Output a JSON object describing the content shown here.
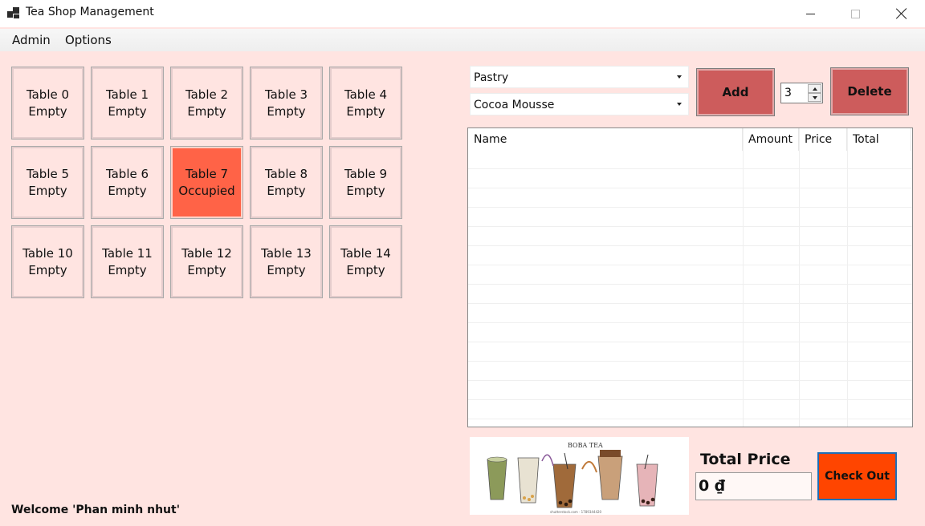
{
  "window": {
    "title": "Tea Shop Management"
  },
  "menu": {
    "admin": "Admin",
    "options": "Options"
  },
  "tables": [
    {
      "name": "Table 0",
      "status": "Empty"
    },
    {
      "name": "Table 1",
      "status": "Empty"
    },
    {
      "name": "Table 2",
      "status": "Empty"
    },
    {
      "name": "Table 3",
      "status": "Empty"
    },
    {
      "name": "Table 4",
      "status": "Empty"
    },
    {
      "name": "Table 5",
      "status": "Empty"
    },
    {
      "name": "Table 6",
      "status": "Empty"
    },
    {
      "name": "Table 7",
      "status": "Occupied"
    },
    {
      "name": "Table 8",
      "status": "Empty"
    },
    {
      "name": "Table 9",
      "status": "Empty"
    },
    {
      "name": "Table 10",
      "status": "Empty"
    },
    {
      "name": "Table 11",
      "status": "Empty"
    },
    {
      "name": "Table 12",
      "status": "Empty"
    },
    {
      "name": "Table 13",
      "status": "Empty"
    },
    {
      "name": "Table 14",
      "status": "Empty"
    }
  ],
  "order": {
    "category": "Pastry",
    "product": "Cocoa Mousse",
    "quantity": "3",
    "add_label": "Add",
    "delete_label": "Delete"
  },
  "bill": {
    "columns": [
      "Name",
      "Amount",
      "Price",
      "Total"
    ],
    "rows": []
  },
  "banner": {
    "heading": "BOBA TEA",
    "caption": "shutterstock.com · 1789344420"
  },
  "total": {
    "label": "Total Price",
    "value": "0 ₫"
  },
  "checkout_label": "Check Out",
  "welcome": "Welcome 'Phan minh nhut'",
  "colors": {
    "background": "#ffe4e1",
    "occupied": "#ff6347",
    "action_button": "#cd5c5c",
    "checkout": "#ff4500"
  }
}
